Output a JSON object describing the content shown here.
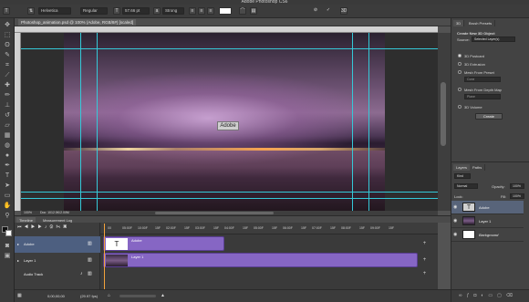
{
  "app": {
    "title": "Adobe Photoshop CS6"
  },
  "options_bar": {
    "font_family": "Helvetica",
    "font_style": "Regular",
    "font_size": "57.66 pt",
    "antialias": "Strong"
  },
  "document": {
    "tab_title": "Photoshop_animation.psd @ 100% (Adobe, RGB/8#) [scaled]",
    "zoom": "100%",
    "doc_info": "Doc: 1012.5K/2.00M",
    "text_layer": "Adobe"
  },
  "right_panel": {
    "tabs": [
      "3D",
      "Brush Presets"
    ],
    "heading": "Create New 3D Object",
    "source_label": "Source:",
    "source_value": "Selected Layer(s)",
    "options": [
      "3D Postcard",
      "3D Extrusion",
      "Mesh From Preset",
      "Mesh From Depth Map",
      "3D Volume"
    ],
    "preset_value": "Cone",
    "depth_value": "Plane",
    "create_label": "Create"
  },
  "layers_panel": {
    "tabs": [
      "Layers",
      "Paths"
    ],
    "kind": "Kind",
    "blend_mode": "Normal",
    "opacity_label": "Opacity:",
    "opacity_value": "100%",
    "lock_label": "Lock:",
    "fill_label": "Fill:",
    "fill_value": "100%",
    "layers": [
      {
        "name": "Adobe",
        "selected": true,
        "type": "text"
      },
      {
        "name": "Layer 1",
        "selected": false,
        "type": "image"
      },
      {
        "name": "Background",
        "selected": false,
        "type": "white"
      }
    ]
  },
  "timeline": {
    "tabs": [
      "Timeline",
      "Measurement Log"
    ],
    "ruler": [
      "00",
      "05:00F",
      "10:00F",
      "15F",
      "02:00F",
      "15F",
      "03:00F",
      "15F",
      "04:00F",
      "15F",
      "05:00F",
      "15F",
      "06:00F",
      "15F",
      "07:00F",
      "15F",
      "08:00F",
      "15F",
      "09:00F",
      "15F"
    ],
    "tracks": [
      {
        "name": "Adobe",
        "clip_label": "Adobe"
      },
      {
        "name": "Layer 1",
        "clip_label": "Layer 1"
      }
    ],
    "audio_track": "Audio Track",
    "timecode": "0;00;00;00",
    "fps": "(29.97 fps)"
  },
  "colors": {
    "accent": "#35c9d8",
    "clip": "#8666c4",
    "playhead": "#f2a23b",
    "selected_track": "#4d5f80"
  }
}
